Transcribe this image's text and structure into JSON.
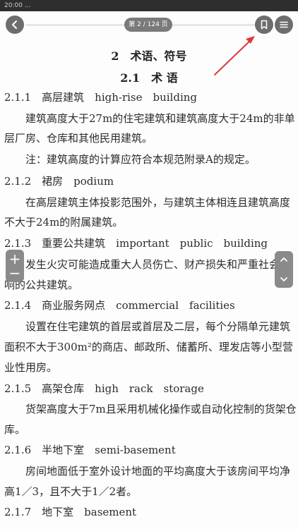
{
  "status_bar": {
    "time": "20:00 ..."
  },
  "toolbar": {
    "back_icon": "chevron-left-icon",
    "page_indicator": "第 2 / 124 页",
    "bookmark_icon": "bookmark-icon",
    "menu_icon": "menu-icon",
    "reading_progress": 0.016
  },
  "document": {
    "chapter_title": "2　术语、符号",
    "section_title": "2.1　术 语",
    "lines": [
      "2.1.1　高层建筑　high-rise　building",
      "建筑高度大于27m的住宅建筑和建筑高度大于24m的非单",
      "层厂房、仓库和其他民用建筑。",
      "注：建筑高度的计算应符合本规范附录A的规定。",
      "2.1.2　裙房　podium",
      "在高层建筑主体投影范围外，与建筑主体相连且建筑高度",
      "不大于24m的附属建筑。",
      "2.1.3　重要公共建筑　important　public　building",
      "发生火灾可能造成重大人员伤亡、财产损失和严重社会影",
      "响的公共建筑。",
      "2.1.4　商业服务网点　commercial　facilities",
      "设置在住宅建筑的首层或首层及二层，每个分隔单元建筑",
      "面积不大于300m²的商店、邮政所、储蓄所、理发店等小型营",
      "业性用房。",
      "2.1.5　高架仓库　high　rack　storage",
      "货架高度大于7m且采用机械化操作或自动化控制的货架仓",
      "库。",
      "2.1.6　半地下室　semi-basement",
      "房间地面低于室外设计地面的平均高度大于该房间平均净",
      "高1／3，且不大于1／2者。",
      "2.1.7　地下室　basement"
    ]
  },
  "zoom_controls": {
    "plus": "+",
    "minus": "−"
  },
  "scroll_controls": {
    "up_icon": "chevron-up-icon",
    "down_icon": "chevron-down-icon"
  },
  "colors": {
    "arrow": "#d93a3a",
    "buttons": "#6d6d6d",
    "page_pill": "#7a7a7a"
  }
}
